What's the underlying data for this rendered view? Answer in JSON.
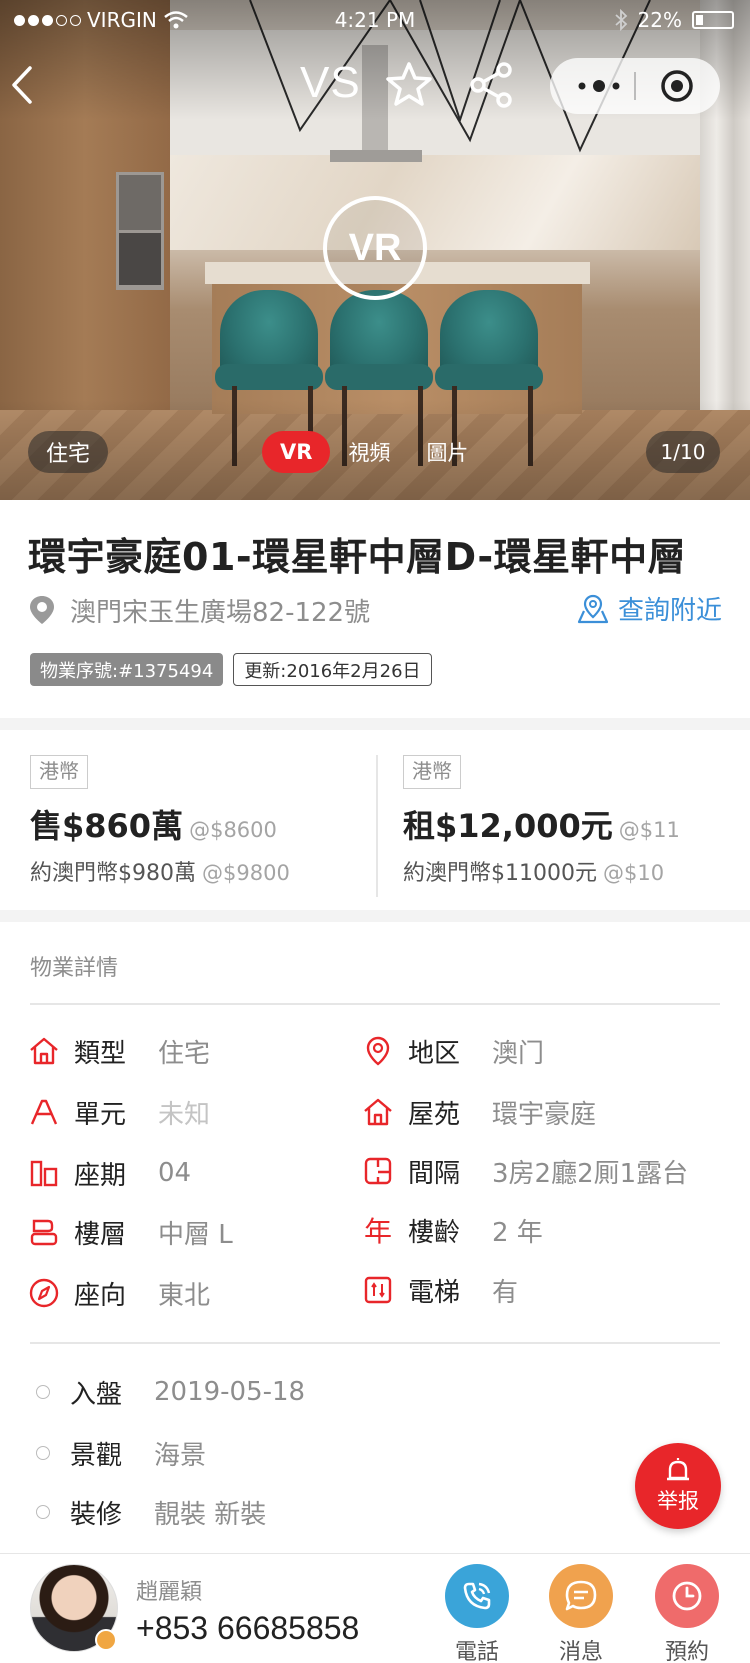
{
  "status_bar": {
    "carrier": "VIRGIN",
    "time": "4:21 PM",
    "battery": "22%",
    "battery_level": 0.22
  },
  "nav": {
    "compare_label": "VS",
    "icons": [
      "back-icon",
      "star-icon",
      "share-icon",
      "more-icon",
      "target-icon"
    ]
  },
  "hero": {
    "vr_badge": "VR",
    "category_tag": "住宅",
    "media_tabs": [
      "VR",
      "視頻",
      "圖片"
    ],
    "active_tab": "VR",
    "counter": "1/10"
  },
  "listing": {
    "title": "環宇豪庭01-環星軒中層D-環星軒中層",
    "address": "澳門宋玉生廣場82-122號",
    "nearby_label": "查詢附近",
    "serial_badge": "物業序號:#1375494",
    "updated_badge": "更新:2016年2月26日"
  },
  "prices": {
    "sale": {
      "currency_tag": "港幣",
      "price": "售$860萬",
      "unit_price": "@$8600",
      "mop_price": "約澳門幣$980萬",
      "mop_unit": "@$9800"
    },
    "rent": {
      "currency_tag": "港幣",
      "price": "租$12,000元",
      "unit_price": "@$11",
      "mop_price": "約澳門幣$11000元",
      "mop_unit": "@$10"
    }
  },
  "details": {
    "section_title": "物業詳情",
    "type": {
      "label": "類型",
      "value": "住宅"
    },
    "district": {
      "label": "地区",
      "value": "澳门"
    },
    "unit": {
      "label": "單元",
      "value": "未知"
    },
    "estate": {
      "label": "屋苑",
      "value": "環宇豪庭"
    },
    "phase": {
      "label": "座期",
      "value": "04"
    },
    "layout": {
      "label": "間隔",
      "value": "3房2廳2厠1露台"
    },
    "floor": {
      "label": "樓層",
      "value": "中層 L"
    },
    "age": {
      "label": "樓齡",
      "value": "2 年"
    },
    "facing": {
      "label": "座向",
      "value": "東北"
    },
    "elevator": {
      "label": "電梯",
      "value": "有"
    },
    "listed": {
      "label": "入盤",
      "value": "2019-05-18"
    },
    "view": {
      "label": "景觀",
      "value": "海景"
    },
    "decoration": {
      "label": "裝修",
      "value": "靚裝 新裝"
    }
  },
  "report_button": {
    "label": "举报"
  },
  "agent": {
    "name": "趙麗穎",
    "phone": "+853 66685858",
    "actions": {
      "call": "電話",
      "message": "消息",
      "book": "預約"
    }
  },
  "colors": {
    "accent_red": "#e8262a",
    "link_blue": "#3b8fd8",
    "call_blue": "#3aa4d9",
    "message_orange": "#f0a24e",
    "book_red": "#ef6b6b"
  }
}
